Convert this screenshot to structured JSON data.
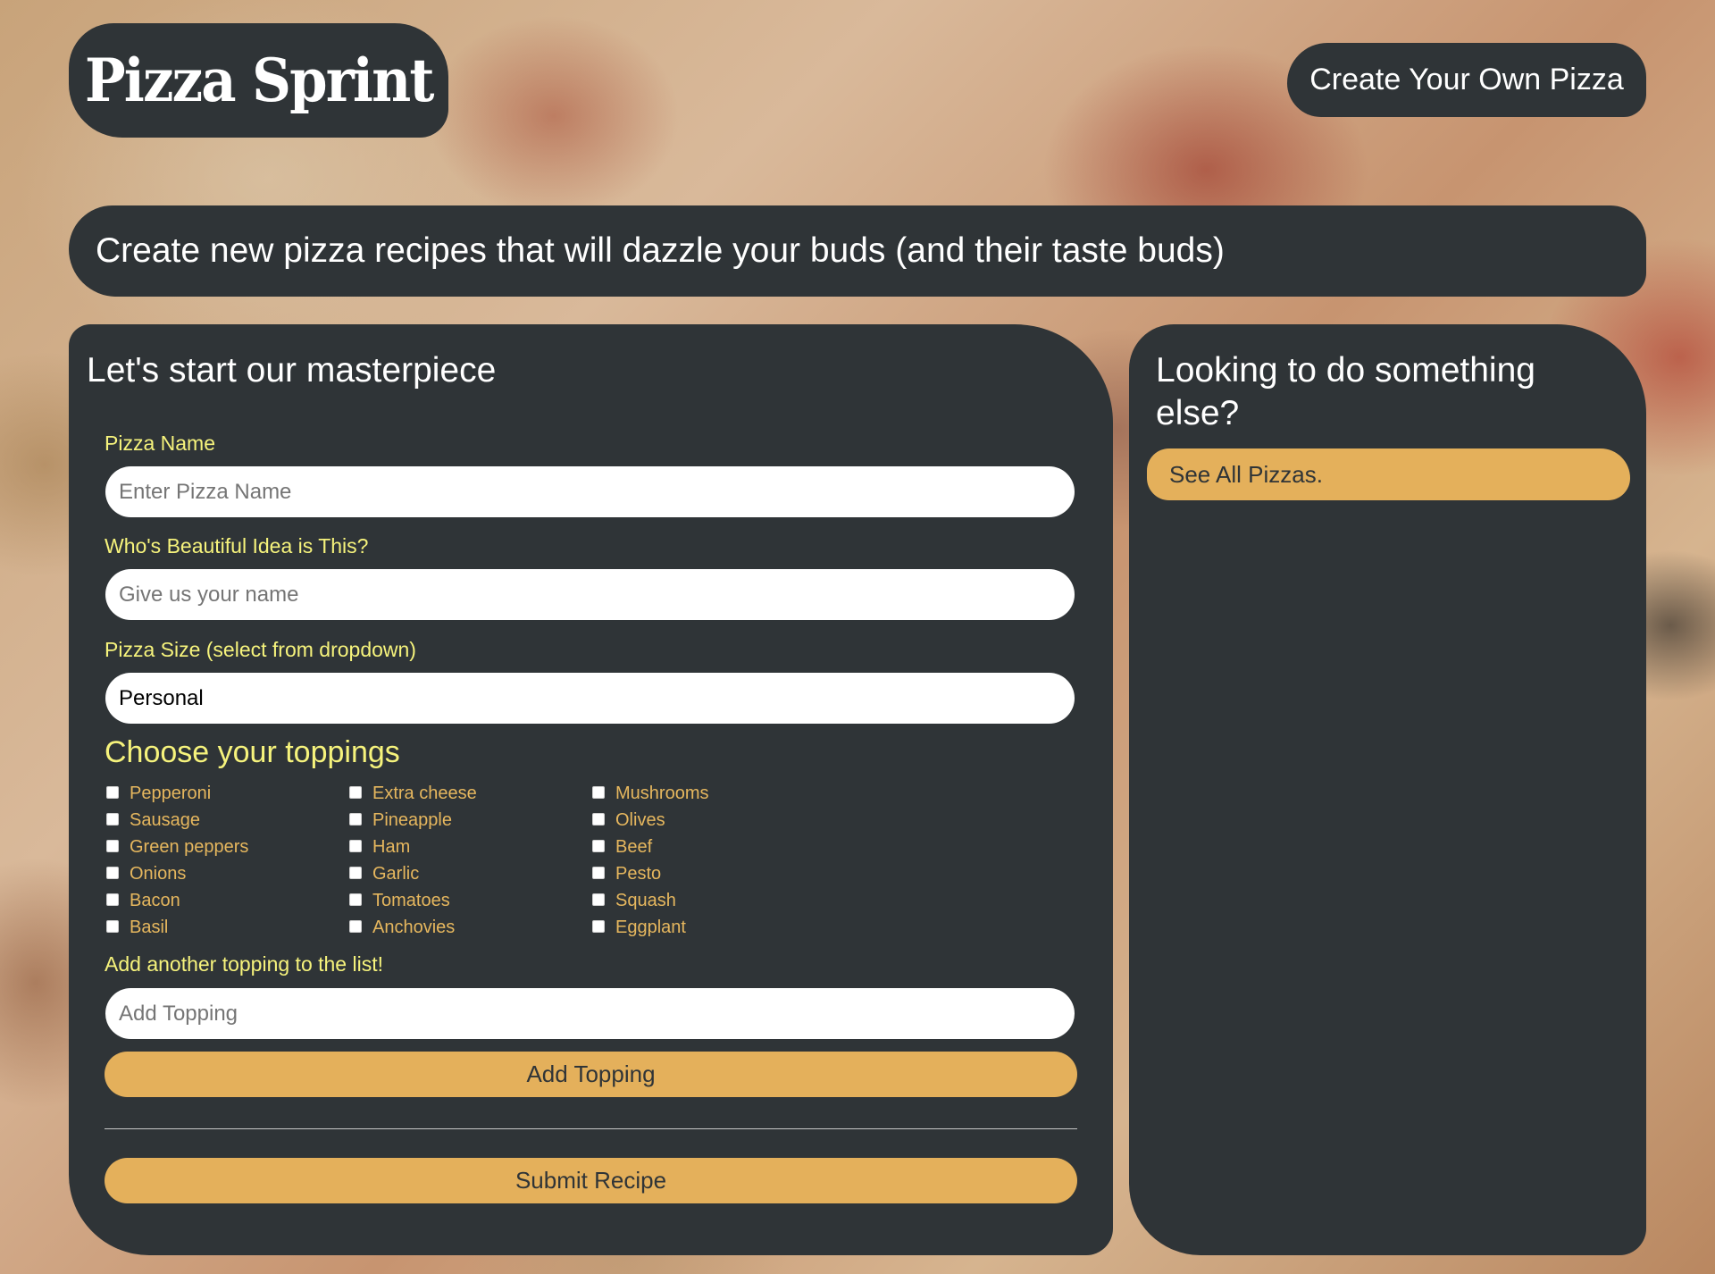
{
  "header": {
    "logo_text": "Pizza Sprint",
    "nav_button": "Create Your Own Pizza"
  },
  "banner": {
    "text": "Create new pizza recipes that will dazzle your buds (and their taste buds)"
  },
  "form": {
    "title": "Let's start our masterpiece",
    "pizza_name": {
      "label": "Pizza Name",
      "placeholder": "Enter Pizza Name",
      "value": ""
    },
    "author": {
      "label": "Who's Beautiful Idea is This?",
      "placeholder": "Give us your name",
      "value": ""
    },
    "size": {
      "label": "Pizza Size (select from dropdown)",
      "selected": "Personal"
    },
    "toppings": {
      "heading": "Choose your toppings",
      "items": [
        {
          "label": "Pepperoni",
          "checked": false
        },
        {
          "label": "Extra cheese",
          "checked": false
        },
        {
          "label": "Mushrooms",
          "checked": false
        },
        {
          "label": "Sausage",
          "checked": false
        },
        {
          "label": "Pineapple",
          "checked": false
        },
        {
          "label": "Olives",
          "checked": false
        },
        {
          "label": "Green peppers",
          "checked": false
        },
        {
          "label": "Ham",
          "checked": false
        },
        {
          "label": "Beef",
          "checked": false
        },
        {
          "label": "Onions",
          "checked": false
        },
        {
          "label": "Garlic",
          "checked": false
        },
        {
          "label": "Pesto",
          "checked": false
        },
        {
          "label": "Bacon",
          "checked": false
        },
        {
          "label": "Tomatoes",
          "checked": false
        },
        {
          "label": "Squash",
          "checked": false
        },
        {
          "label": "Basil",
          "checked": false
        },
        {
          "label": "Anchovies",
          "checked": false
        },
        {
          "label": "Eggplant",
          "checked": false
        }
      ]
    },
    "add_topping": {
      "label": "Add another topping to the list!",
      "placeholder": "Add Topping",
      "value": "",
      "button": "Add Topping"
    },
    "submit_button": "Submit Recipe"
  },
  "sidebar": {
    "title": "Looking to do something else?",
    "link": "See All Pizzas."
  },
  "colors": {
    "panel": "#2f3437",
    "label_yellow": "#f6f37c",
    "topping_gold": "#e6b75e",
    "button_gold": "#e4b05b"
  }
}
